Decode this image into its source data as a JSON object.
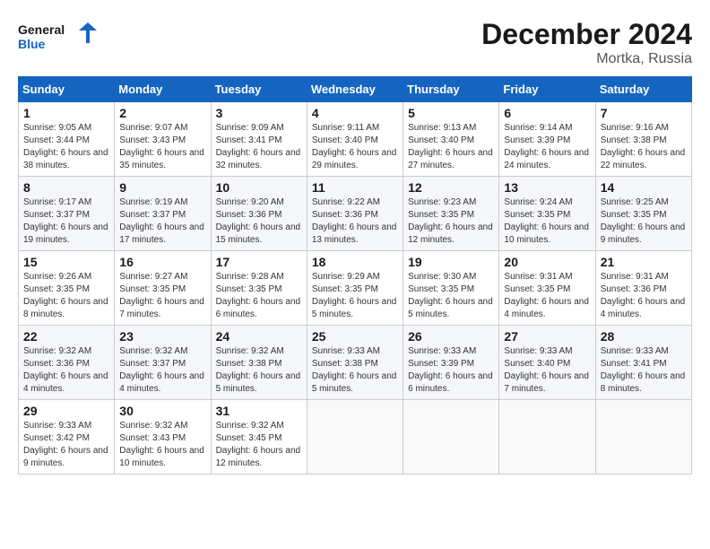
{
  "logo": {
    "text_general": "General",
    "text_blue": "Blue"
  },
  "header": {
    "month": "December 2024",
    "location": "Mortka, Russia"
  },
  "weekdays": [
    "Sunday",
    "Monday",
    "Tuesday",
    "Wednesday",
    "Thursday",
    "Friday",
    "Saturday"
  ],
  "weeks": [
    [
      {
        "day": "1",
        "sunrise": "Sunrise: 9:05 AM",
        "sunset": "Sunset: 3:44 PM",
        "daylight": "Daylight: 6 hours and 38 minutes."
      },
      {
        "day": "2",
        "sunrise": "Sunrise: 9:07 AM",
        "sunset": "Sunset: 3:43 PM",
        "daylight": "Daylight: 6 hours and 35 minutes."
      },
      {
        "day": "3",
        "sunrise": "Sunrise: 9:09 AM",
        "sunset": "Sunset: 3:41 PM",
        "daylight": "Daylight: 6 hours and 32 minutes."
      },
      {
        "day": "4",
        "sunrise": "Sunrise: 9:11 AM",
        "sunset": "Sunset: 3:40 PM",
        "daylight": "Daylight: 6 hours and 29 minutes."
      },
      {
        "day": "5",
        "sunrise": "Sunrise: 9:13 AM",
        "sunset": "Sunset: 3:40 PM",
        "daylight": "Daylight: 6 hours and 27 minutes."
      },
      {
        "day": "6",
        "sunrise": "Sunrise: 9:14 AM",
        "sunset": "Sunset: 3:39 PM",
        "daylight": "Daylight: 6 hours and 24 minutes."
      },
      {
        "day": "7",
        "sunrise": "Sunrise: 9:16 AM",
        "sunset": "Sunset: 3:38 PM",
        "daylight": "Daylight: 6 hours and 22 minutes."
      }
    ],
    [
      {
        "day": "8",
        "sunrise": "Sunrise: 9:17 AM",
        "sunset": "Sunset: 3:37 PM",
        "daylight": "Daylight: 6 hours and 19 minutes."
      },
      {
        "day": "9",
        "sunrise": "Sunrise: 9:19 AM",
        "sunset": "Sunset: 3:37 PM",
        "daylight": "Daylight: 6 hours and 17 minutes."
      },
      {
        "day": "10",
        "sunrise": "Sunrise: 9:20 AM",
        "sunset": "Sunset: 3:36 PM",
        "daylight": "Daylight: 6 hours and 15 minutes."
      },
      {
        "day": "11",
        "sunrise": "Sunrise: 9:22 AM",
        "sunset": "Sunset: 3:36 PM",
        "daylight": "Daylight: 6 hours and 13 minutes."
      },
      {
        "day": "12",
        "sunrise": "Sunrise: 9:23 AM",
        "sunset": "Sunset: 3:35 PM",
        "daylight": "Daylight: 6 hours and 12 minutes."
      },
      {
        "day": "13",
        "sunrise": "Sunrise: 9:24 AM",
        "sunset": "Sunset: 3:35 PM",
        "daylight": "Daylight: 6 hours and 10 minutes."
      },
      {
        "day": "14",
        "sunrise": "Sunrise: 9:25 AM",
        "sunset": "Sunset: 3:35 PM",
        "daylight": "Daylight: 6 hours and 9 minutes."
      }
    ],
    [
      {
        "day": "15",
        "sunrise": "Sunrise: 9:26 AM",
        "sunset": "Sunset: 3:35 PM",
        "daylight": "Daylight: 6 hours and 8 minutes."
      },
      {
        "day": "16",
        "sunrise": "Sunrise: 9:27 AM",
        "sunset": "Sunset: 3:35 PM",
        "daylight": "Daylight: 6 hours and 7 minutes."
      },
      {
        "day": "17",
        "sunrise": "Sunrise: 9:28 AM",
        "sunset": "Sunset: 3:35 PM",
        "daylight": "Daylight: 6 hours and 6 minutes."
      },
      {
        "day": "18",
        "sunrise": "Sunrise: 9:29 AM",
        "sunset": "Sunset: 3:35 PM",
        "daylight": "Daylight: 6 hours and 5 minutes."
      },
      {
        "day": "19",
        "sunrise": "Sunrise: 9:30 AM",
        "sunset": "Sunset: 3:35 PM",
        "daylight": "Daylight: 6 hours and 5 minutes."
      },
      {
        "day": "20",
        "sunrise": "Sunrise: 9:31 AM",
        "sunset": "Sunset: 3:35 PM",
        "daylight": "Daylight: 6 hours and 4 minutes."
      },
      {
        "day": "21",
        "sunrise": "Sunrise: 9:31 AM",
        "sunset": "Sunset: 3:36 PM",
        "daylight": "Daylight: 6 hours and 4 minutes."
      }
    ],
    [
      {
        "day": "22",
        "sunrise": "Sunrise: 9:32 AM",
        "sunset": "Sunset: 3:36 PM",
        "daylight": "Daylight: 6 hours and 4 minutes."
      },
      {
        "day": "23",
        "sunrise": "Sunrise: 9:32 AM",
        "sunset": "Sunset: 3:37 PM",
        "daylight": "Daylight: 6 hours and 4 minutes."
      },
      {
        "day": "24",
        "sunrise": "Sunrise: 9:32 AM",
        "sunset": "Sunset: 3:38 PM",
        "daylight": "Daylight: 6 hours and 5 minutes."
      },
      {
        "day": "25",
        "sunrise": "Sunrise: 9:33 AM",
        "sunset": "Sunset: 3:38 PM",
        "daylight": "Daylight: 6 hours and 5 minutes."
      },
      {
        "day": "26",
        "sunrise": "Sunrise: 9:33 AM",
        "sunset": "Sunset: 3:39 PM",
        "daylight": "Daylight: 6 hours and 6 minutes."
      },
      {
        "day": "27",
        "sunrise": "Sunrise: 9:33 AM",
        "sunset": "Sunset: 3:40 PM",
        "daylight": "Daylight: 6 hours and 7 minutes."
      },
      {
        "day": "28",
        "sunrise": "Sunrise: 9:33 AM",
        "sunset": "Sunset: 3:41 PM",
        "daylight": "Daylight: 6 hours and 8 minutes."
      }
    ],
    [
      {
        "day": "29",
        "sunrise": "Sunrise: 9:33 AM",
        "sunset": "Sunset: 3:42 PM",
        "daylight": "Daylight: 6 hours and 9 minutes."
      },
      {
        "day": "30",
        "sunrise": "Sunrise: 9:32 AM",
        "sunset": "Sunset: 3:43 PM",
        "daylight": "Daylight: 6 hours and 10 minutes."
      },
      {
        "day": "31",
        "sunrise": "Sunrise: 9:32 AM",
        "sunset": "Sunset: 3:45 PM",
        "daylight": "Daylight: 6 hours and 12 minutes."
      },
      null,
      null,
      null,
      null
    ]
  ]
}
